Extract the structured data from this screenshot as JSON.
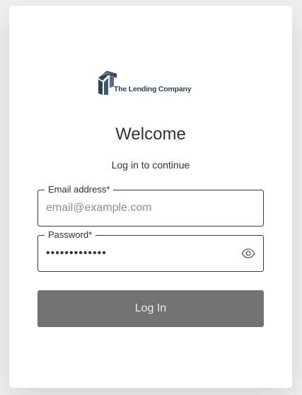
{
  "logo": {
    "text": "The Lending Company",
    "brand_color": "#2f4556"
  },
  "header": {
    "title": "Welcome",
    "subtitle": "Log in to continue"
  },
  "form": {
    "email": {
      "label": "Email address*",
      "placeholder": "email@example.com",
      "value": ""
    },
    "password": {
      "label": "Password*",
      "value": "•••••••••••••",
      "toggle_icon": "eye-icon"
    },
    "submit_label": "Log In"
  },
  "colors": {
    "button_bg": "#727272",
    "button_text": "#ececec",
    "text": "#2d333a",
    "border": "#3b3b3b"
  }
}
